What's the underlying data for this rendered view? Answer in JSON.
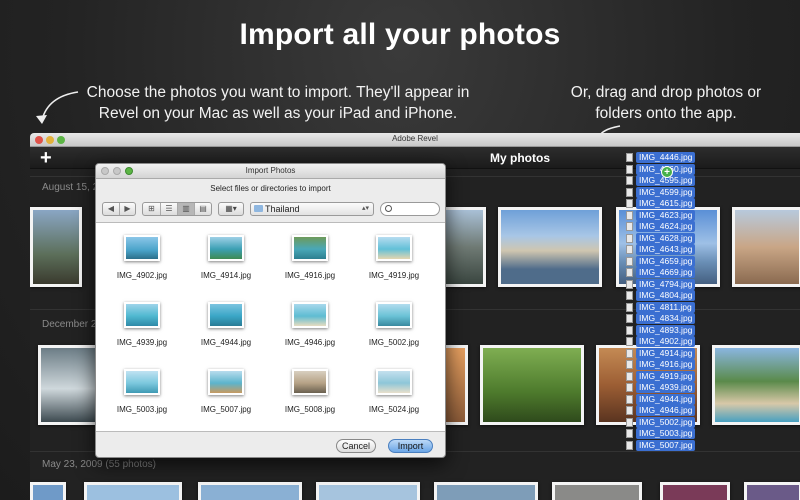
{
  "headline": "Import all your photos",
  "caption_left": "Choose the photos you want to import. They'll appear in Revel on your Mac as well as your iPad and iPhone.",
  "caption_right": "Or, drag and drop photos or folders onto the app.",
  "app": {
    "window_title": "Adobe Revel",
    "add_button": "+",
    "section_title": "My photos",
    "dates": [
      "August 15, 2",
      "December 2",
      "May 23, 2009 (55 photos)"
    ]
  },
  "dialog": {
    "title": "Import Photos",
    "instruction": "Select files or directories to import",
    "location": "Thailand",
    "cancel_label": "Cancel",
    "import_label": "Import",
    "files": [
      "IMG_4902.jpg",
      "IMG_4914.jpg",
      "IMG_4916.jpg",
      "IMG_4919.jpg",
      "IMG_4939.jpg",
      "IMG_4944.jpg",
      "IMG_4946.jpg",
      "IMG_5002.jpg",
      "IMG_5003.jpg",
      "IMG_5007.jpg",
      "IMG_5008.jpg",
      "IMG_5024.jpg"
    ]
  },
  "drag_files": [
    "IMG_4446.jpg",
    "IMG_4560.jpg",
    "IMG_4595.jpg",
    "IMG_4599.jpg",
    "IMG_4615.jpg",
    "IMG_4623.jpg",
    "IMG_4624.jpg",
    "IMG_4628.jpg",
    "IMG_4643.jpg",
    "IMG_4659.jpg",
    "IMG_4669.jpg",
    "IMG_4794.jpg",
    "IMG_4804.jpg",
    "IMG_4811.jpg",
    "IMG_4834.jpg",
    "IMG_4893.jpg",
    "IMG_4902.jpg",
    "IMG_4914.jpg",
    "IMG_4916.jpg",
    "IMG_4919.jpg",
    "IMG_4939.jpg",
    "IMG_4944.jpg",
    "IMG_4946.jpg",
    "IMG_5002.jpg",
    "IMG_5003.jpg",
    "IMG_5007.jpg"
  ],
  "icons": {
    "arrow": "curved-arrow-icon",
    "folder": "folder-icon",
    "search": "search-icon",
    "document": "document-icon",
    "add_badge": "plus-badge-icon"
  },
  "colors": {
    "selection": "#3b6fd1",
    "primary_button": "#6aa5e6",
    "background": "#262626"
  }
}
